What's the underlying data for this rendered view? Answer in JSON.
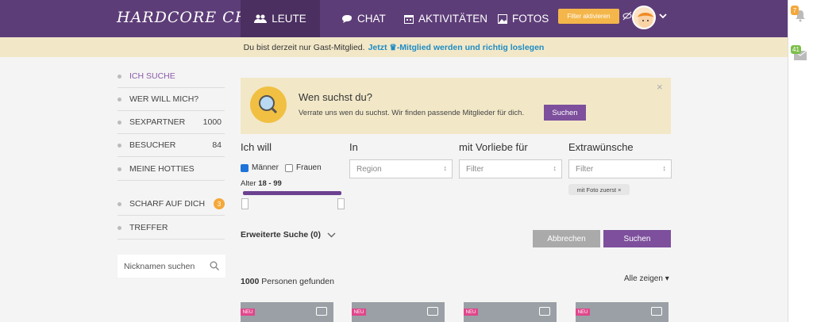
{
  "header": {
    "logo": "HARDCORE CHAT",
    "nav": [
      {
        "label": "LEUTE",
        "icon": "people-icon"
      },
      {
        "label": "CHAT",
        "icon": "chat-bubble-icon"
      },
      {
        "label": "AKTIVITÄTEN",
        "icon": "calendar-icon"
      },
      {
        "label": "FOTOS",
        "icon": "photo-icon"
      }
    ],
    "filter_button": "Filter aktivieren"
  },
  "notice": {
    "text": "Du bist derzeit nur Gast-Mitglied.",
    "link": "Jetzt ♛-Mitglied werden und richtig loslegen"
  },
  "rail": {
    "notifications": "7",
    "messages": "41"
  },
  "sidebar": {
    "items": [
      {
        "label": "ICH SUCHE",
        "count": ""
      },
      {
        "label": "WER WILL MICH?",
        "count": ""
      },
      {
        "label": "SEXPARTNER",
        "count": "1000"
      },
      {
        "label": "BESUCHER",
        "count": "84"
      },
      {
        "label": "MEINE HOTTIES",
        "count": ""
      },
      {
        "label": "SCHARF AUF DICH",
        "count": "3"
      },
      {
        "label": "TREFFER",
        "count": ""
      }
    ],
    "nick_placeholder": "Nicknamen suchen"
  },
  "search_box": {
    "title": "Wen suchst du?",
    "subtitle": "Verrate uns wen du suchst. Wir finden passende Mitglieder für dich.",
    "button": "Suchen",
    "close": "×"
  },
  "filters": {
    "ich_will": "Ich will",
    "in": "In",
    "vorliebe": "mit Vorliebe für",
    "extra": "Extrawünsche",
    "maenner": "Männer",
    "frauen": "Frauen",
    "age_label": "Alter",
    "age_range": "18 - 99",
    "region": "Region",
    "filter1": "Filter",
    "filter2": "Filter",
    "tag": "mit Foto zuerst ×"
  },
  "actions": {
    "extended": "Erweiterte Suche (0)",
    "cancel": "Abbrechen",
    "search": "Suchen"
  },
  "results": {
    "count": "1000",
    "count_suffix": "Personen gefunden",
    "show_all": "Alle zeigen ▾",
    "new_badge": "NEU"
  }
}
